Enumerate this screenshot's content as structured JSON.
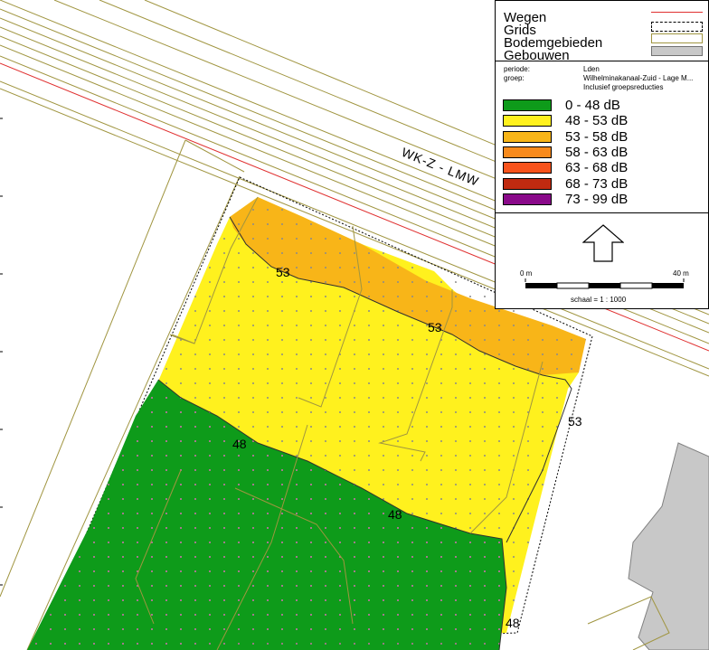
{
  "map": {
    "road_label": "WK-Z - LMW",
    "contour_labels": [
      {
        "id": "c53a",
        "text": "53"
      },
      {
        "id": "c53b",
        "text": "53"
      },
      {
        "id": "c53c",
        "text": "53"
      },
      {
        "id": "c48a",
        "text": "48"
      },
      {
        "id": "c48b",
        "text": "48"
      },
      {
        "id": "c48c",
        "text": "48"
      }
    ]
  },
  "legend": {
    "layers": [
      {
        "label": "Wegen",
        "color": "#e03030"
      },
      {
        "label": "Grids",
        "color": "#000000"
      },
      {
        "label": "Bodemgebieden",
        "color": "#e8e8a0"
      },
      {
        "label": "Gebouwen",
        "color": "#c8c8c8"
      }
    ],
    "info": {
      "periode_key": "periode:",
      "periode_val": "Lden",
      "groep_key": "groep:",
      "groep_val": "Wilhelminakanaal-Zuid - Lage M...",
      "groep_note": "Inclusief groepsreducties"
    },
    "classes": [
      {
        "label": "0 - 48 dB",
        "color": "#0e9b1a"
      },
      {
        "label": "48 - 53 dB",
        "color": "#fff11e"
      },
      {
        "label": "53 - 58 dB",
        "color": "#f8b518"
      },
      {
        "label": "58 - 63 dB",
        "color": "#f88a1c"
      },
      {
        "label": "63 - 68 dB",
        "color": "#f8531c"
      },
      {
        "label": "68 - 73 dB",
        "color": "#c02a10"
      },
      {
        "label": "73 - 99 dB",
        "color": "#8a0a8a"
      }
    ],
    "scale": {
      "start": "0 m",
      "end": "40 m",
      "ratio": "schaal = 1 : 1000"
    }
  },
  "colors": {
    "green": "#0e9b1a",
    "yellow": "#fff11e",
    "orange": "#f8b518",
    "building_gray": "#c8c8c8",
    "olive_line": "#a09540",
    "road_red": "#e03030"
  }
}
